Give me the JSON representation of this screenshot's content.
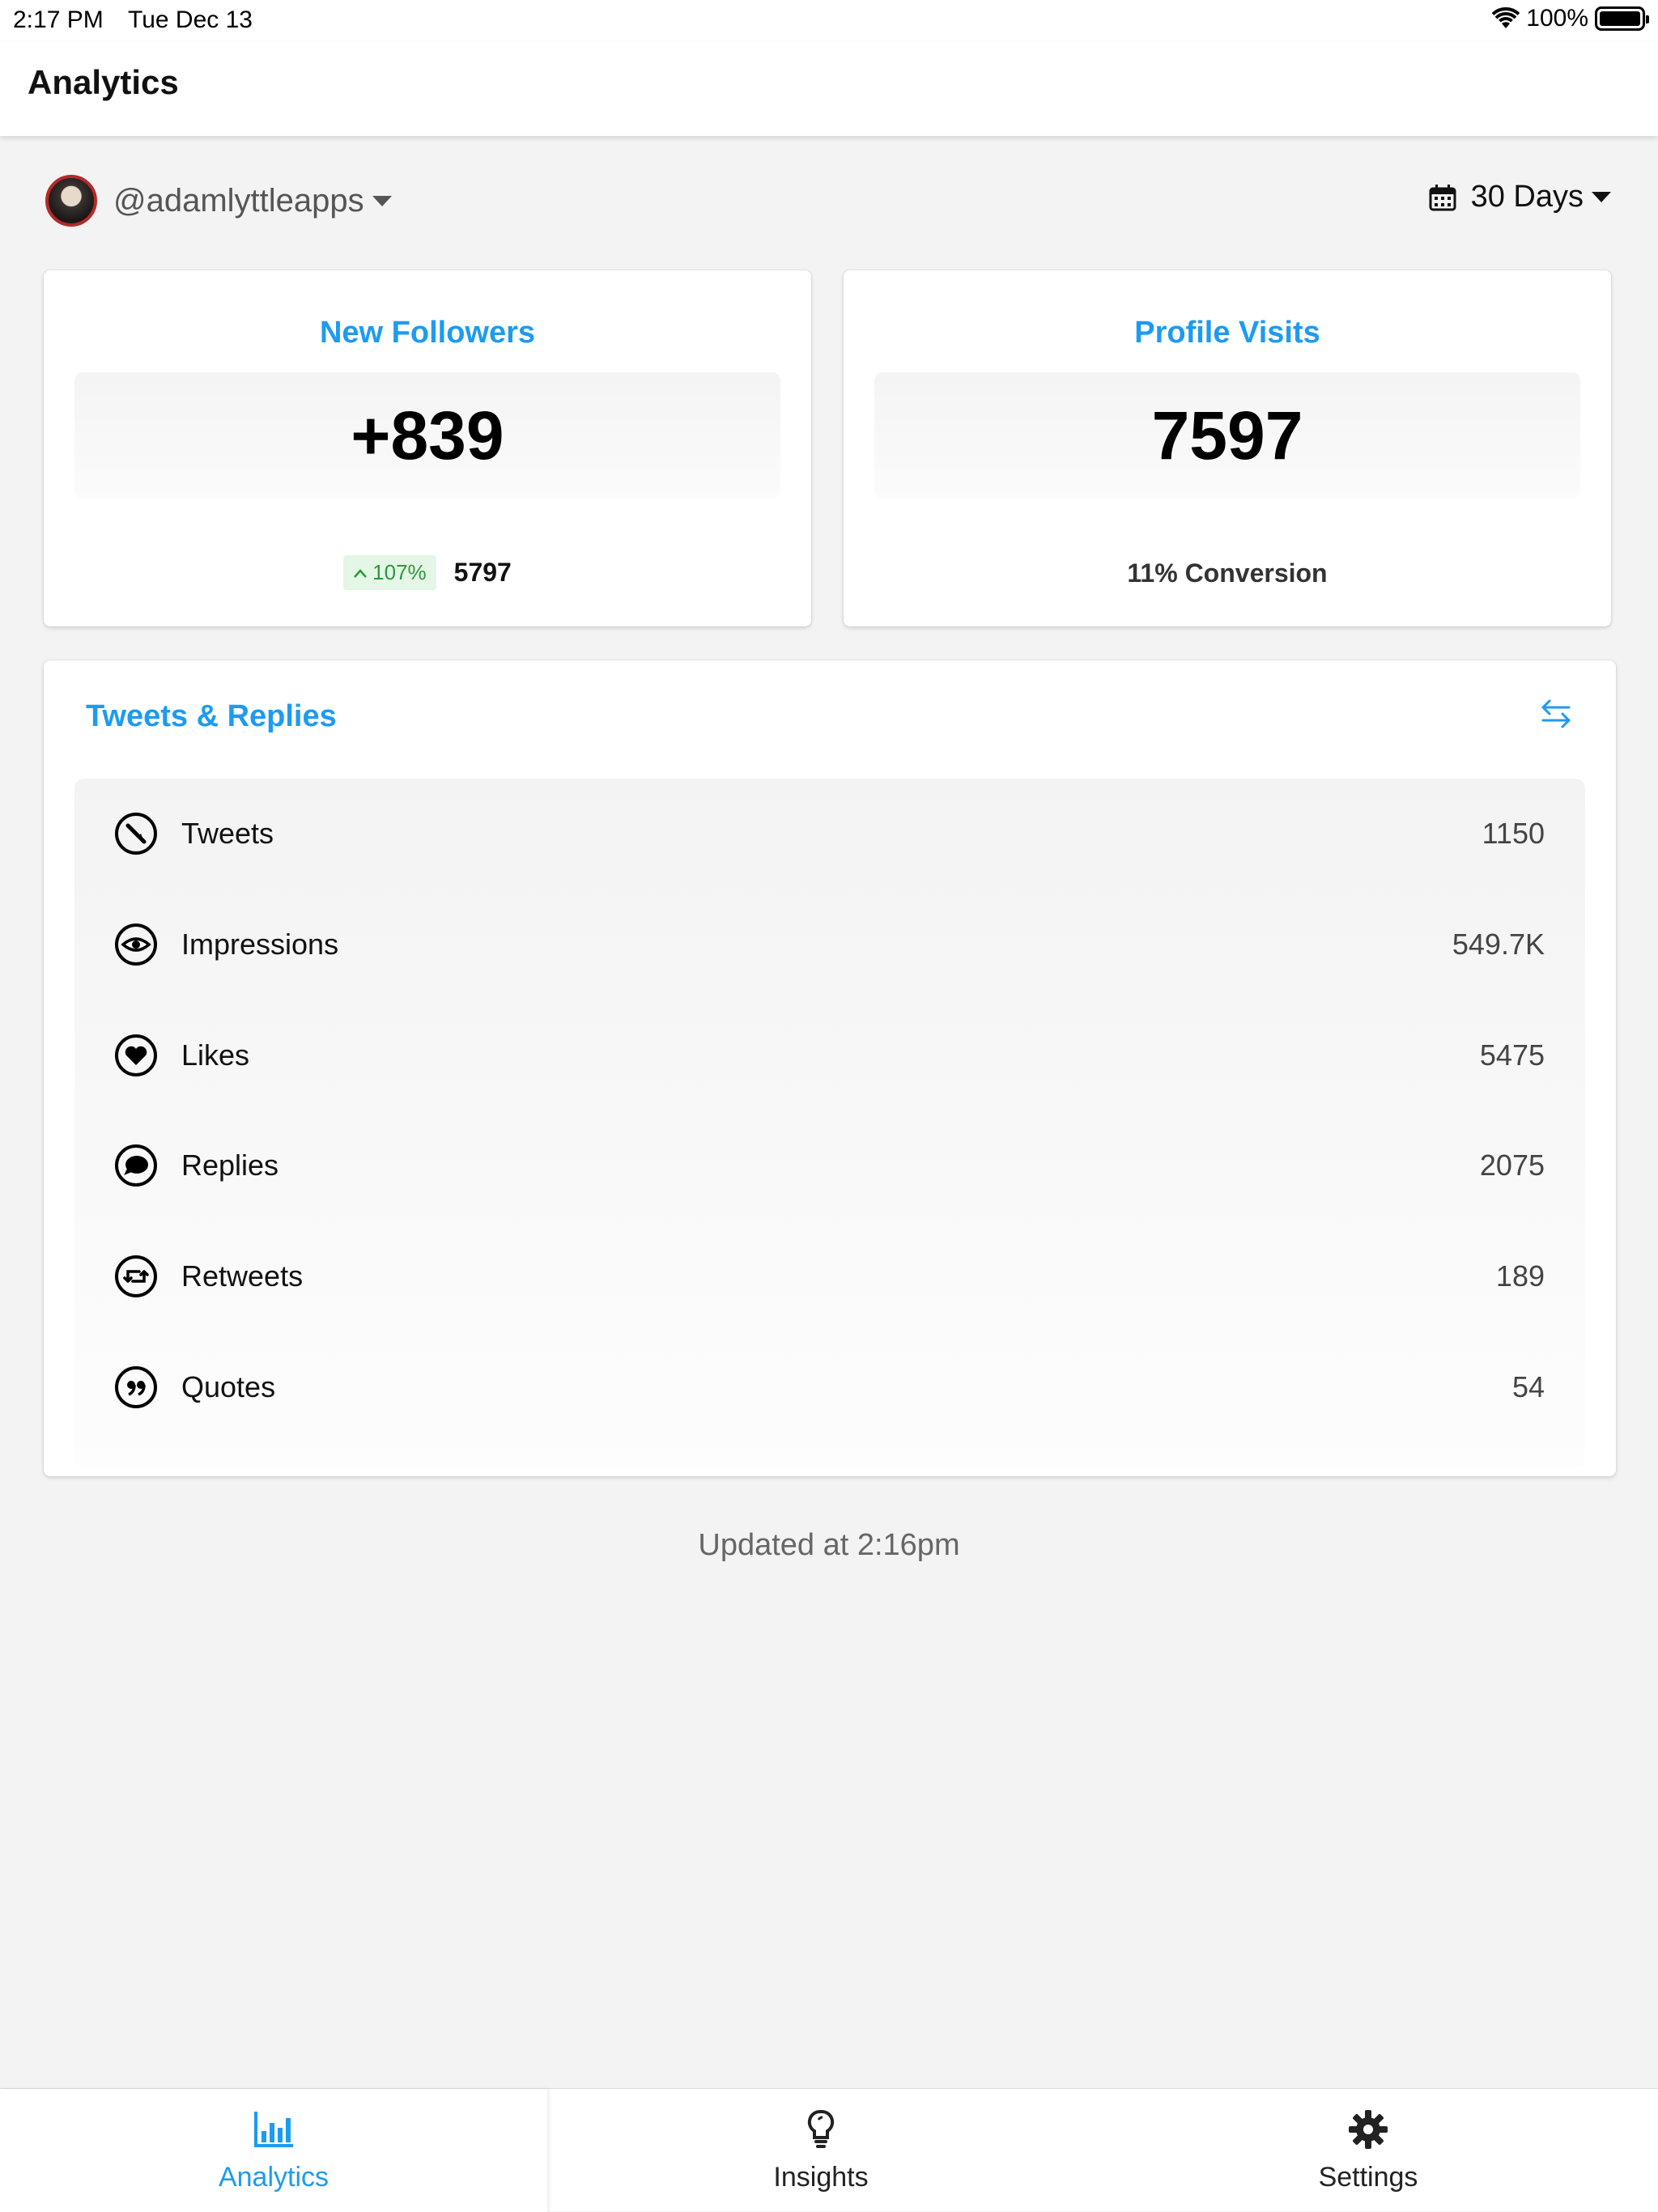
{
  "status_bar": {
    "time": "2:17 PM",
    "date": "Tue Dec 13",
    "battery": "100%"
  },
  "nav": {
    "title": "Analytics"
  },
  "account": {
    "handle": "@adamlyttleapps"
  },
  "range": {
    "label": "30 Days"
  },
  "followers_card": {
    "title": "New Followers",
    "value": "+839",
    "change": "107%",
    "total": "5797"
  },
  "visits_card": {
    "title": "Profile Visits",
    "value": "7597",
    "conversion": "11% Conversion"
  },
  "tweets_card": {
    "title": "Tweets & Replies",
    "rows": [
      {
        "label": "Tweets",
        "value": "1150",
        "icon": "quill-icon"
      },
      {
        "label": "Impressions",
        "value": "549.7K",
        "icon": "eye-icon"
      },
      {
        "label": "Likes",
        "value": "5475",
        "icon": "heart-icon"
      },
      {
        "label": "Replies",
        "value": "2075",
        "icon": "comment-icon"
      },
      {
        "label": "Retweets",
        "value": "189",
        "icon": "retweet-icon"
      },
      {
        "label": "Quotes",
        "value": "54",
        "icon": "quote-icon"
      }
    ]
  },
  "footer": {
    "updated": "Updated at 2:16pm"
  },
  "tabs": [
    {
      "label": "Analytics",
      "icon": "bar-chart-icon",
      "active": true
    },
    {
      "label": "Insights",
      "icon": "lightbulb-icon",
      "active": false
    },
    {
      "label": "Settings",
      "icon": "gear-icon",
      "active": false
    }
  ],
  "colors": {
    "accent": "#1d9bf0",
    "positive": "#2b9a3a",
    "background": "#f3f3f3"
  }
}
